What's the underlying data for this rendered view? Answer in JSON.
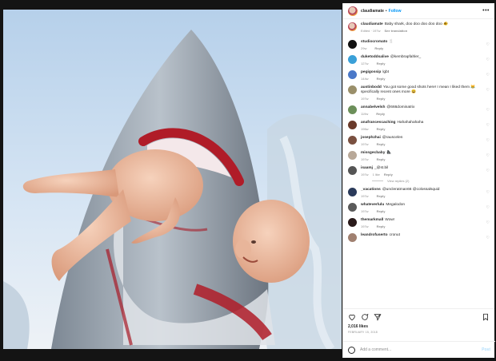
{
  "post": {
    "username": "claudiamate",
    "separator": "•",
    "follow_label": "Follow",
    "more_icon": "more-horizontal-icon",
    "likes": "2,016 likes",
    "date": "FEBRUARY 15, 2018",
    "add_comment_placeholder": "Add a comment...",
    "post_label": "Post"
  },
  "caption": {
    "username": "claudiamate",
    "text": "Baby shark, doo doo doo doo doo 🐠",
    "edited": "Edited · 197w",
    "see_translation": "See translation"
  },
  "comments": [
    {
      "user": "studiocromato",
      "text": "🍴",
      "age": "29w",
      "likes": "",
      "reply": "Reply",
      "avatar_color": "#111111"
    },
    {
      "user": "duketoddsalive",
      "text": "@kembrapfahler_",
      "age": "127w",
      "likes": "",
      "reply": "Reply",
      "avatar_color": "#3aa0d8"
    },
    {
      "user": "pegigossip",
      "text": "lgbt",
      "age": "144w",
      "likes": "",
      "reply": "Reply",
      "avatar_color": "#4a78c8"
    },
    {
      "user": "austinbodd",
      "text": "You got some good shots here! I mean I liked them 😹 specifically recent ones more 😆",
      "age": "197w",
      "likes": "",
      "reply": "Reply",
      "avatar_color": "#9a8f6a"
    },
    {
      "user": "annabelvelsh",
      "text": "@666dominatrix",
      "age": "119w",
      "likes": "",
      "reply": "Reply",
      "avatar_color": "#6c8f5a"
    },
    {
      "user": "anafrancescaching",
      "text": "Hahahahahaha",
      "age": "196w",
      "likes": "",
      "reply": "Reply",
      "avatar_color": "#6a3a2a"
    },
    {
      "user": "josephzhai",
      "text": "@rauscelen",
      "age": "197w",
      "likes": "",
      "reply": "Reply",
      "avatar_color": "#7a5040"
    },
    {
      "user": "missgecbaby",
      "text": "🦍",
      "age": "197w",
      "likes": "",
      "reply": "Reply",
      "avatar_color": "#b8a898"
    },
    {
      "user": "isaamj",
      "text": "_@st.bil",
      "age": "197w",
      "likes": "1 like",
      "reply": "Reply",
      "avatar_color": "#555555"
    },
    {
      "user": "_vacations",
      "text": "@uncleratman66 @colossalsquid",
      "age": "197w",
      "likes": "",
      "reply": "Reply",
      "avatar_color": "#2a3a5a"
    },
    {
      "user": "whateverlulu",
      "text": "Megalodon",
      "age": "197w",
      "likes": "",
      "reply": "Reply",
      "avatar_color": "#5a5a5a"
    },
    {
      "user": "themarkmall",
      "text": "Wow!",
      "age": "197w",
      "likes": "",
      "reply": "Reply",
      "avatar_color": "#2a1a1a"
    },
    {
      "user": "leandrofuserto",
      "text": "cronut",
      "age": "",
      "likes": "",
      "reply": "",
      "avatar_color": "#a08070"
    }
  ],
  "view_replies": "View replies (2)",
  "icons": {
    "like": "heart-icon",
    "comment": "comment-icon",
    "share": "share-icon",
    "save": "bookmark-icon",
    "emoji": "emoji-icon"
  }
}
